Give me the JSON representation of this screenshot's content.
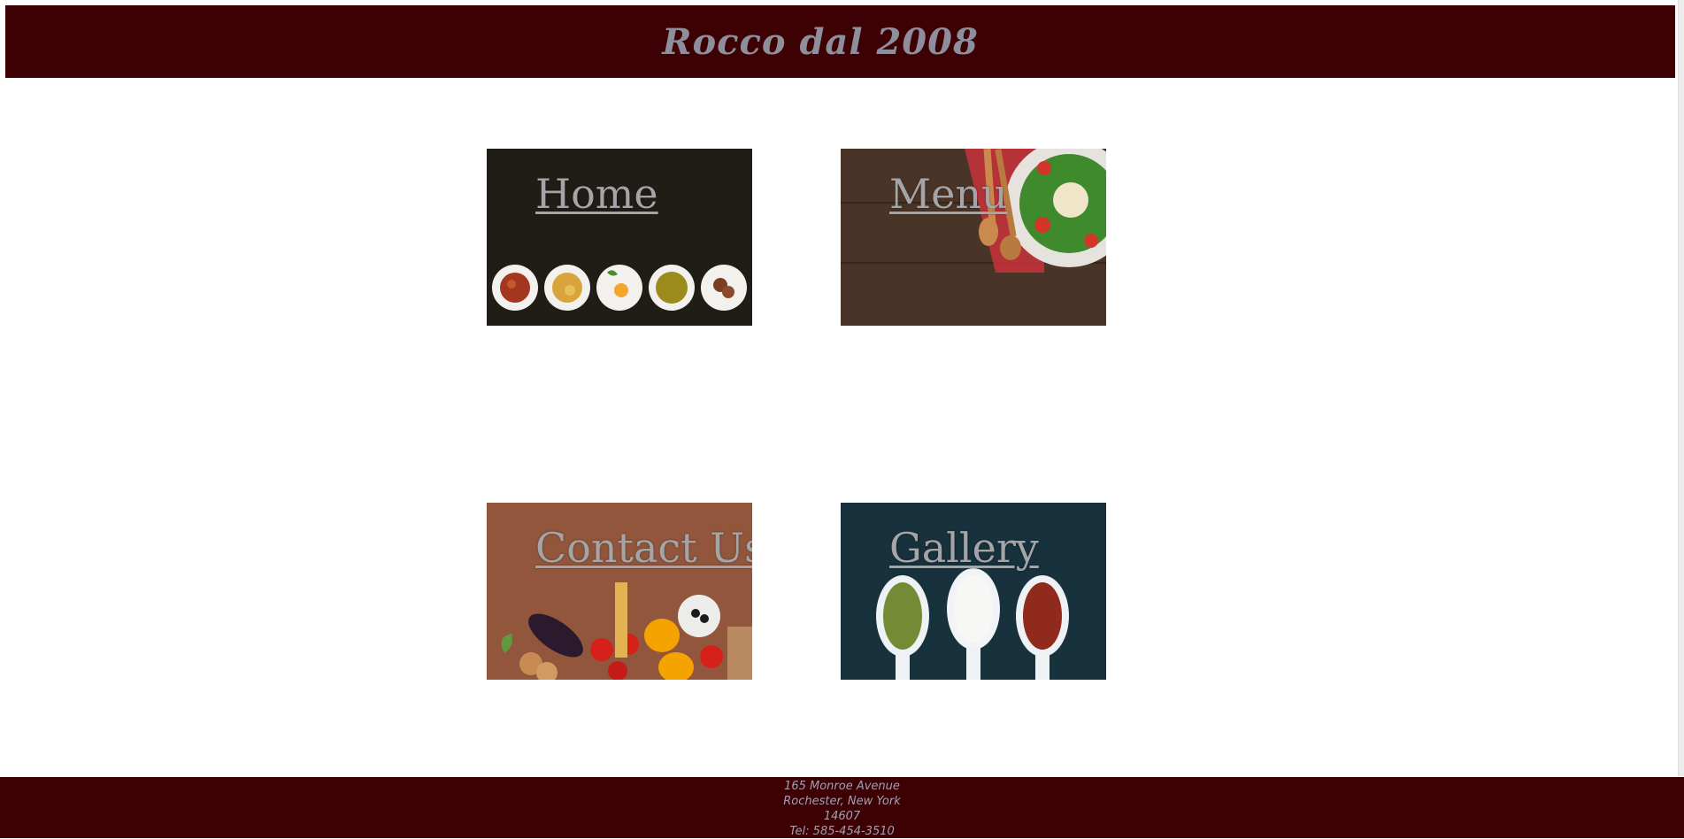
{
  "header": {
    "title": "Rocco dal 2008"
  },
  "tiles": [
    {
      "label": "Home",
      "image": "food-bowls-on-dark-board"
    },
    {
      "label": "Menu",
      "image": "salad-plate-with-wooden-spoons"
    },
    {
      "label": "Contact Us",
      "image": "vegetables-and-pasta-on-wood"
    },
    {
      "label": "Gallery",
      "image": "spice-spoons-on-slate"
    }
  ],
  "footer": {
    "address_line1": "165 Monroe Avenue",
    "address_line2": "Rochester, New York",
    "zip": "14607",
    "phone": "Tel: 585-454-3510"
  },
  "colors": {
    "header_bg": "#3d0003",
    "footer_bg": "#3d0003",
    "title_text": "#8e8e9c",
    "label_text": "#a5a5a8"
  }
}
